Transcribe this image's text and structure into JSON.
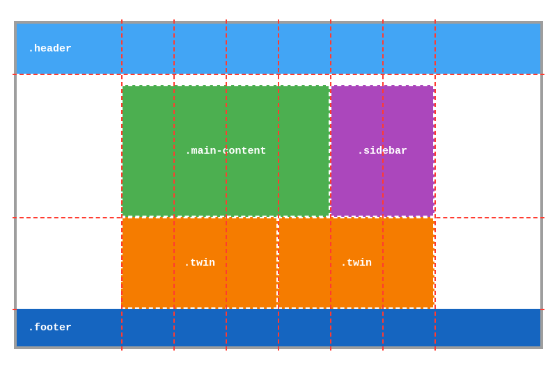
{
  "diagram": {
    "header_label": ".header",
    "main_label": ".main-content",
    "sidebar_label": ".sidebar",
    "twin_label": ".twin",
    "footer_label": ".footer"
  }
}
